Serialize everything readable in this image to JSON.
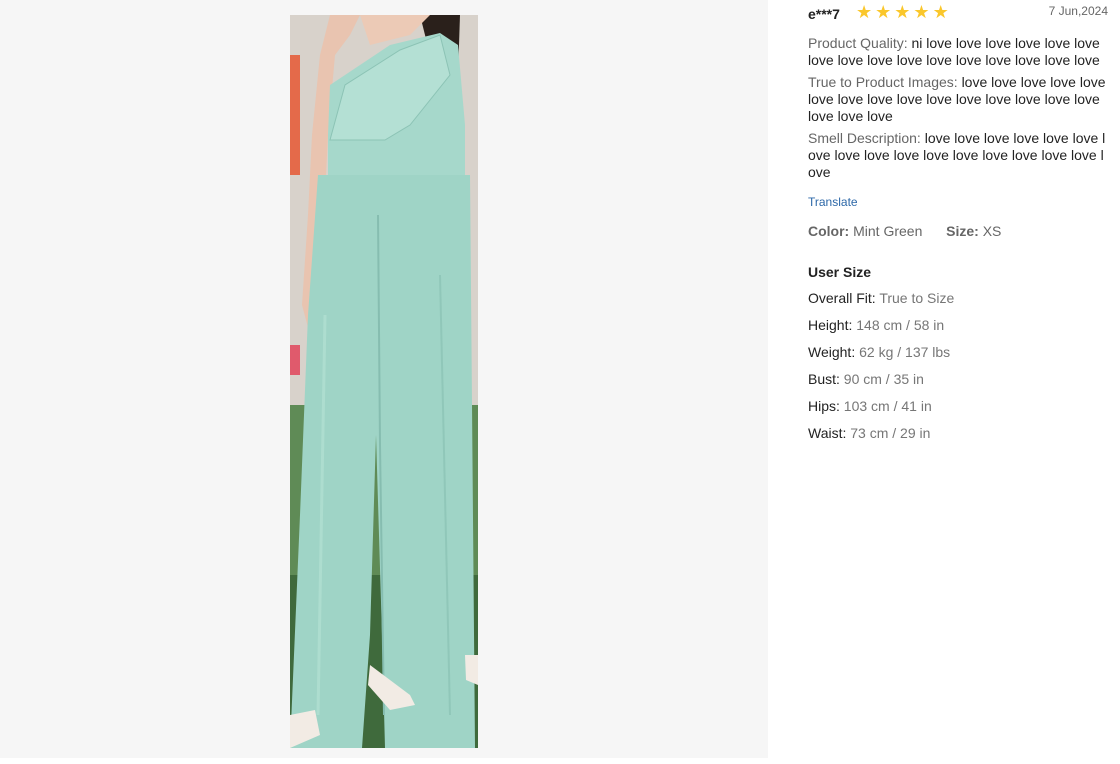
{
  "review": {
    "username": "e***7",
    "rating": 5,
    "date": "7 Jun,2024",
    "star_color": "#fac72c",
    "attributes": [
      {
        "label": "Product Quality:",
        "value": "ni love love love love love love love love love love love love love love love love"
      },
      {
        "label": "True to Product Images:",
        "value": "love love love love love love love love love love love love love love love love love love"
      },
      {
        "label": "Smell Description:",
        "value": "love love love love love love love love love love love love love love love love love"
      }
    ],
    "translate_label": "Translate",
    "color_label": "Color:",
    "color_value": "Mint Green",
    "size_label": "Size:",
    "size_value": "XS"
  },
  "user_size": {
    "title": "User Size",
    "rows": [
      {
        "label": "Overall Fit:",
        "value": "True to Size"
      },
      {
        "label": "Height:",
        "value": "148 cm / 58 in"
      },
      {
        "label": "Weight:",
        "value": "62 kg / 137 lbs"
      },
      {
        "label": "Bust:",
        "value": "90 cm / 35 in"
      },
      {
        "label": "Hips:",
        "value": "103 cm / 41 in"
      },
      {
        "label": "Waist:",
        "value": "73 cm / 29 in"
      }
    ]
  },
  "photo": {
    "subject": "mint green one-shoulder jumpsuit",
    "garment_color": "#9fd4c6"
  }
}
